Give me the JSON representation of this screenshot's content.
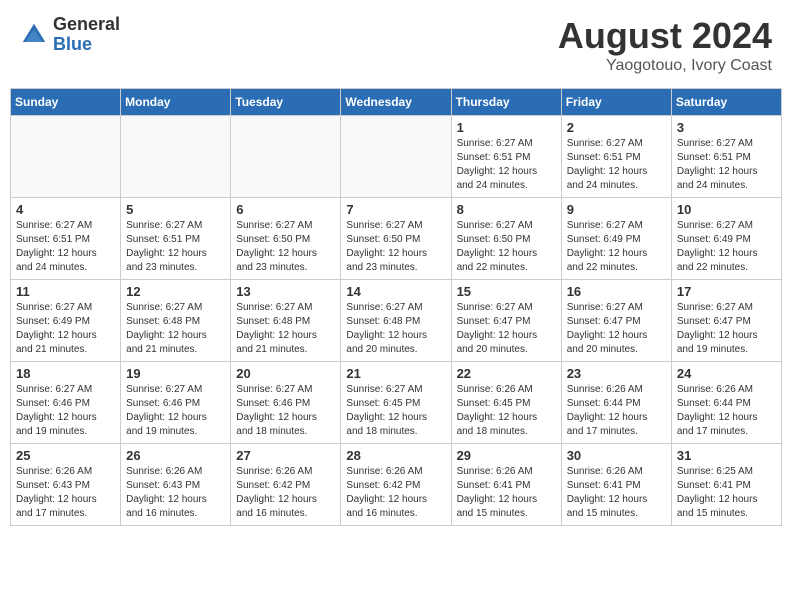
{
  "header": {
    "logo": {
      "general": "General",
      "blue": "Blue"
    },
    "title": "August 2024",
    "location": "Yaogotouo, Ivory Coast"
  },
  "weekdays": [
    "Sunday",
    "Monday",
    "Tuesday",
    "Wednesday",
    "Thursday",
    "Friday",
    "Saturday"
  ],
  "weeks": [
    [
      {
        "day": "",
        "info": ""
      },
      {
        "day": "",
        "info": ""
      },
      {
        "day": "",
        "info": ""
      },
      {
        "day": "",
        "info": ""
      },
      {
        "day": "1",
        "info": "Sunrise: 6:27 AM\nSunset: 6:51 PM\nDaylight: 12 hours\nand 24 minutes."
      },
      {
        "day": "2",
        "info": "Sunrise: 6:27 AM\nSunset: 6:51 PM\nDaylight: 12 hours\nand 24 minutes."
      },
      {
        "day": "3",
        "info": "Sunrise: 6:27 AM\nSunset: 6:51 PM\nDaylight: 12 hours\nand 24 minutes."
      }
    ],
    [
      {
        "day": "4",
        "info": "Sunrise: 6:27 AM\nSunset: 6:51 PM\nDaylight: 12 hours\nand 24 minutes."
      },
      {
        "day": "5",
        "info": "Sunrise: 6:27 AM\nSunset: 6:51 PM\nDaylight: 12 hours\nand 23 minutes."
      },
      {
        "day": "6",
        "info": "Sunrise: 6:27 AM\nSunset: 6:50 PM\nDaylight: 12 hours\nand 23 minutes."
      },
      {
        "day": "7",
        "info": "Sunrise: 6:27 AM\nSunset: 6:50 PM\nDaylight: 12 hours\nand 23 minutes."
      },
      {
        "day": "8",
        "info": "Sunrise: 6:27 AM\nSunset: 6:50 PM\nDaylight: 12 hours\nand 22 minutes."
      },
      {
        "day": "9",
        "info": "Sunrise: 6:27 AM\nSunset: 6:49 PM\nDaylight: 12 hours\nand 22 minutes."
      },
      {
        "day": "10",
        "info": "Sunrise: 6:27 AM\nSunset: 6:49 PM\nDaylight: 12 hours\nand 22 minutes."
      }
    ],
    [
      {
        "day": "11",
        "info": "Sunrise: 6:27 AM\nSunset: 6:49 PM\nDaylight: 12 hours\nand 21 minutes."
      },
      {
        "day": "12",
        "info": "Sunrise: 6:27 AM\nSunset: 6:48 PM\nDaylight: 12 hours\nand 21 minutes."
      },
      {
        "day": "13",
        "info": "Sunrise: 6:27 AM\nSunset: 6:48 PM\nDaylight: 12 hours\nand 21 minutes."
      },
      {
        "day": "14",
        "info": "Sunrise: 6:27 AM\nSunset: 6:48 PM\nDaylight: 12 hours\nand 20 minutes."
      },
      {
        "day": "15",
        "info": "Sunrise: 6:27 AM\nSunset: 6:47 PM\nDaylight: 12 hours\nand 20 minutes."
      },
      {
        "day": "16",
        "info": "Sunrise: 6:27 AM\nSunset: 6:47 PM\nDaylight: 12 hours\nand 20 minutes."
      },
      {
        "day": "17",
        "info": "Sunrise: 6:27 AM\nSunset: 6:47 PM\nDaylight: 12 hours\nand 19 minutes."
      }
    ],
    [
      {
        "day": "18",
        "info": "Sunrise: 6:27 AM\nSunset: 6:46 PM\nDaylight: 12 hours\nand 19 minutes."
      },
      {
        "day": "19",
        "info": "Sunrise: 6:27 AM\nSunset: 6:46 PM\nDaylight: 12 hours\nand 19 minutes."
      },
      {
        "day": "20",
        "info": "Sunrise: 6:27 AM\nSunset: 6:46 PM\nDaylight: 12 hours\nand 18 minutes."
      },
      {
        "day": "21",
        "info": "Sunrise: 6:27 AM\nSunset: 6:45 PM\nDaylight: 12 hours\nand 18 minutes."
      },
      {
        "day": "22",
        "info": "Sunrise: 6:26 AM\nSunset: 6:45 PM\nDaylight: 12 hours\nand 18 minutes."
      },
      {
        "day": "23",
        "info": "Sunrise: 6:26 AM\nSunset: 6:44 PM\nDaylight: 12 hours\nand 17 minutes."
      },
      {
        "day": "24",
        "info": "Sunrise: 6:26 AM\nSunset: 6:44 PM\nDaylight: 12 hours\nand 17 minutes."
      }
    ],
    [
      {
        "day": "25",
        "info": "Sunrise: 6:26 AM\nSunset: 6:43 PM\nDaylight: 12 hours\nand 17 minutes."
      },
      {
        "day": "26",
        "info": "Sunrise: 6:26 AM\nSunset: 6:43 PM\nDaylight: 12 hours\nand 16 minutes."
      },
      {
        "day": "27",
        "info": "Sunrise: 6:26 AM\nSunset: 6:42 PM\nDaylight: 12 hours\nand 16 minutes."
      },
      {
        "day": "28",
        "info": "Sunrise: 6:26 AM\nSunset: 6:42 PM\nDaylight: 12 hours\nand 16 minutes."
      },
      {
        "day": "29",
        "info": "Sunrise: 6:26 AM\nSunset: 6:41 PM\nDaylight: 12 hours\nand 15 minutes."
      },
      {
        "day": "30",
        "info": "Sunrise: 6:26 AM\nSunset: 6:41 PM\nDaylight: 12 hours\nand 15 minutes."
      },
      {
        "day": "31",
        "info": "Sunrise: 6:25 AM\nSunset: 6:41 PM\nDaylight: 12 hours\nand 15 minutes."
      }
    ]
  ]
}
